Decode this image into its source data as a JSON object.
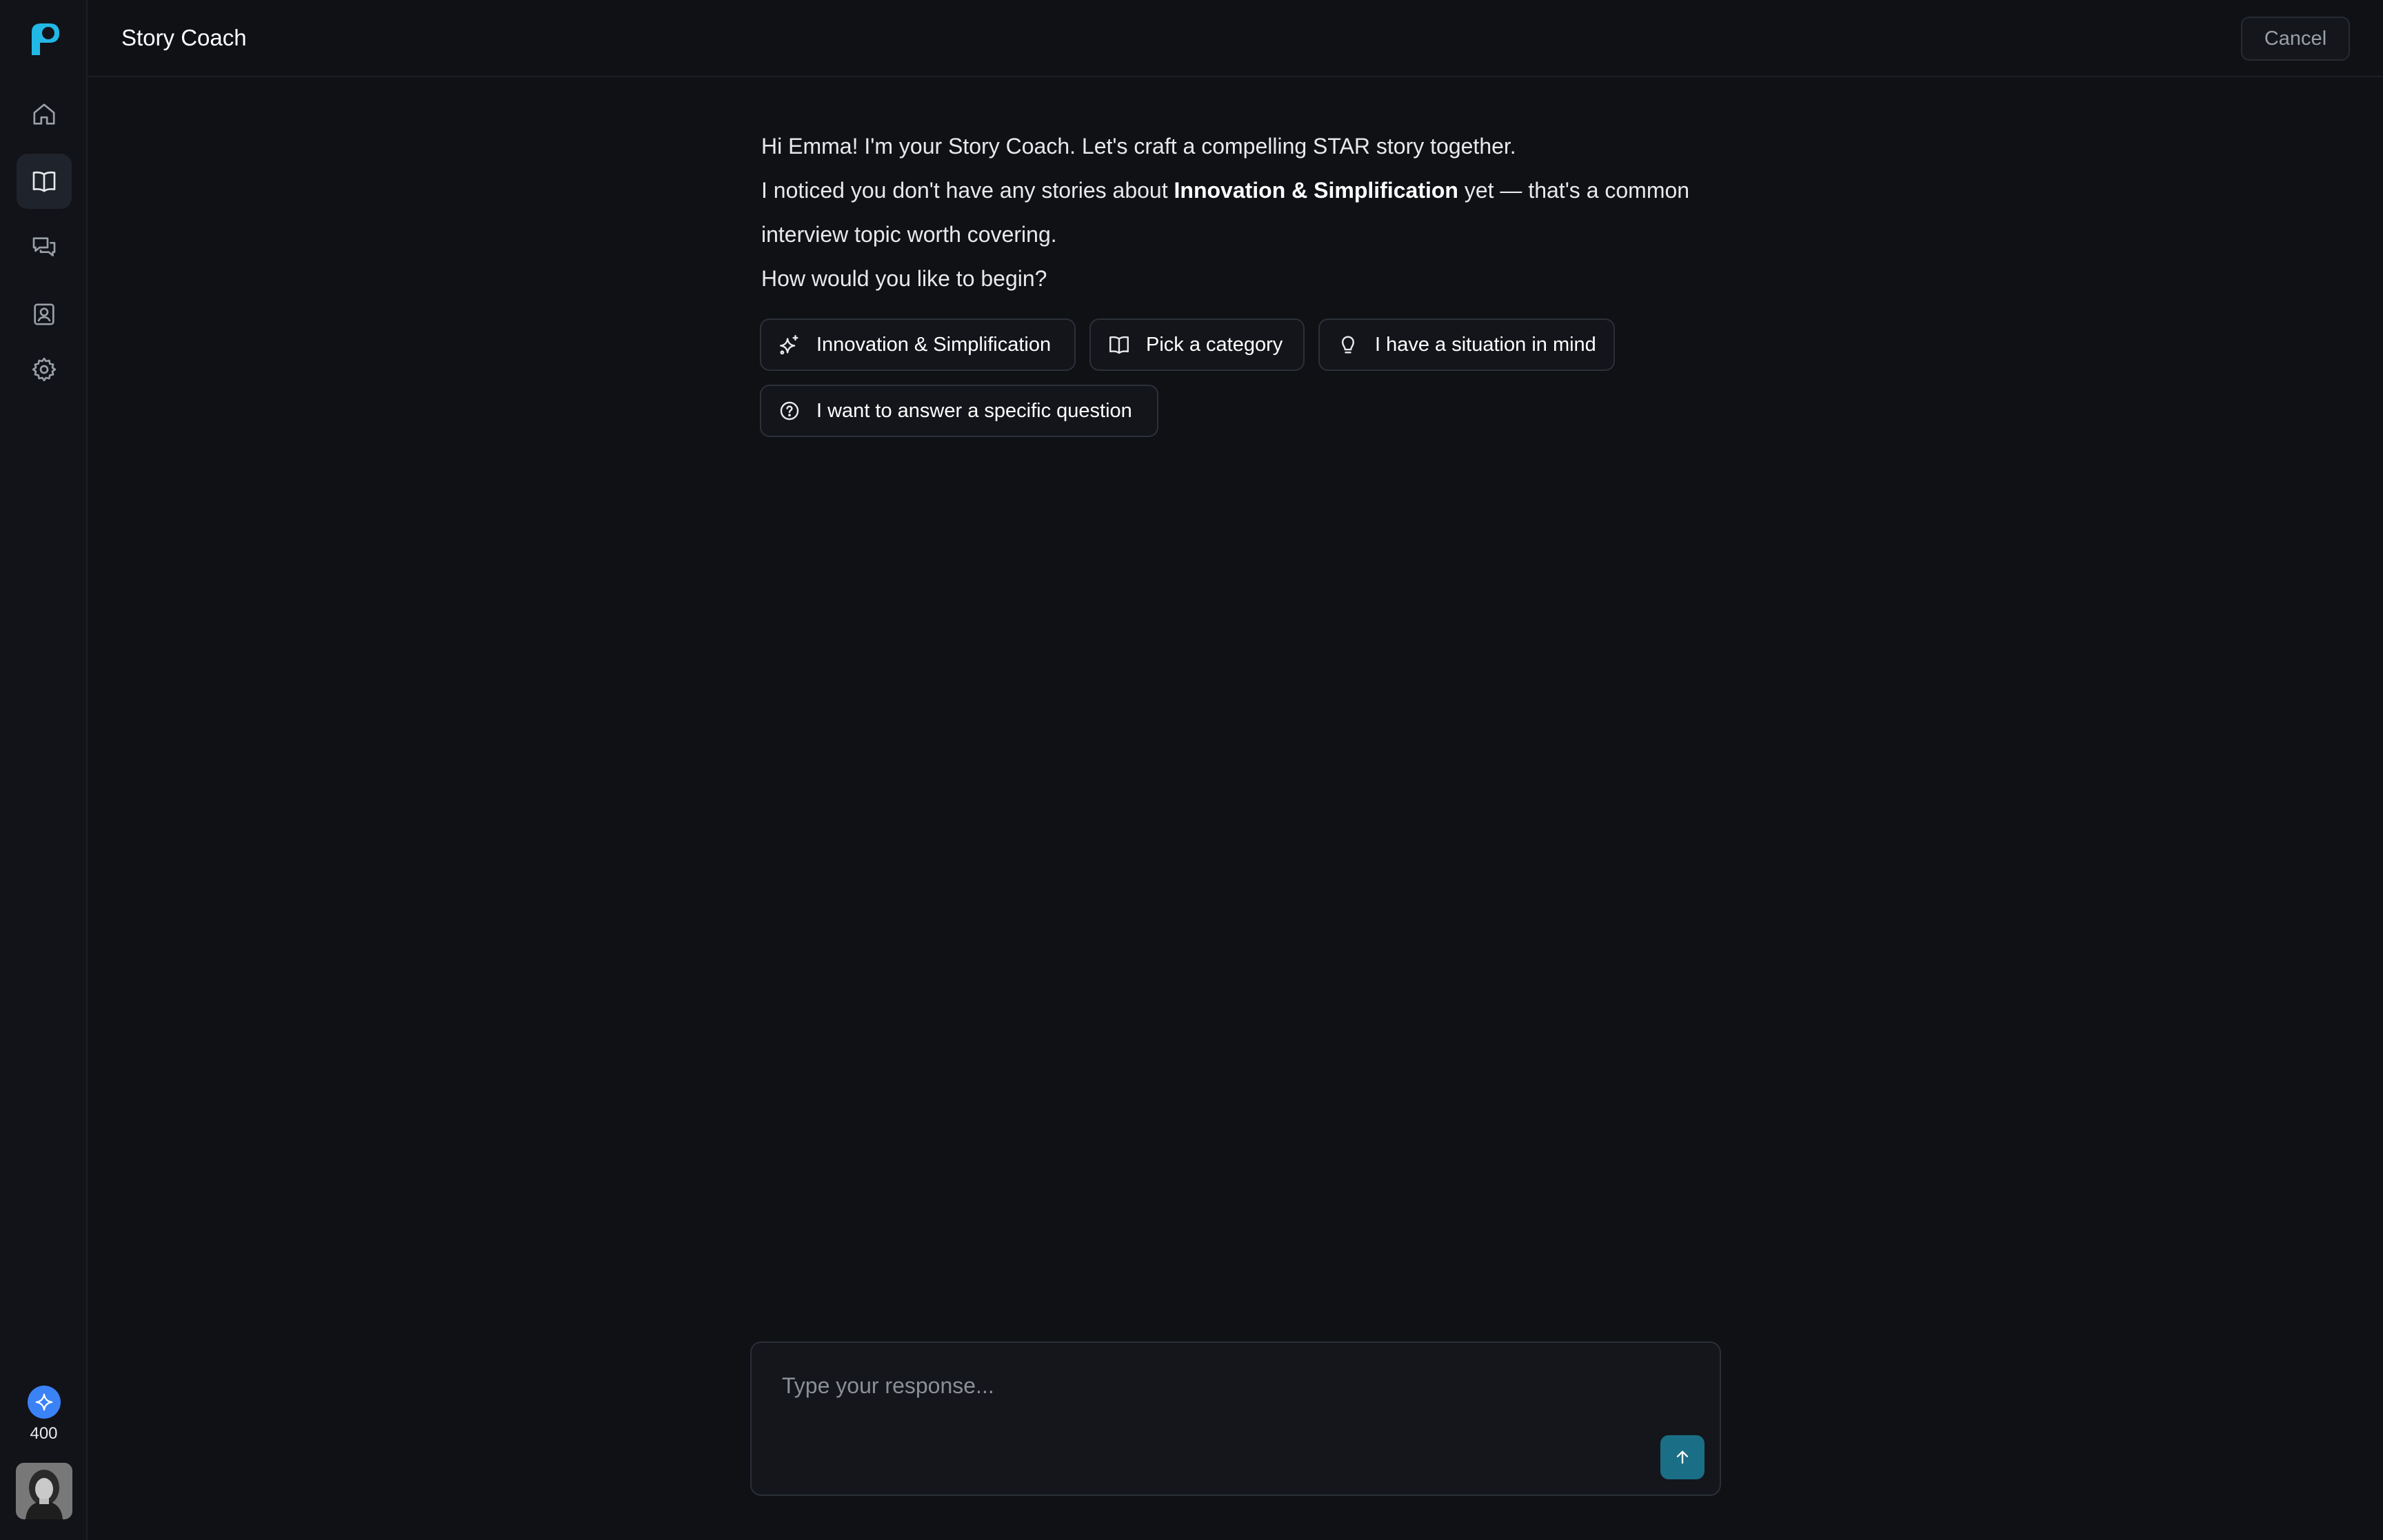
{
  "header": {
    "title": "Story Coach",
    "cancel_label": "Cancel"
  },
  "sidebar": {
    "items": [
      {
        "name": "home"
      },
      {
        "name": "stories",
        "active": true
      },
      {
        "name": "conversations"
      },
      {
        "name": "profile"
      },
      {
        "name": "settings"
      }
    ],
    "credits": "400"
  },
  "chat": {
    "line1": "Hi Emma! I'm your Story Coach. Let's craft a compelling STAR story together.",
    "line2_pre": "I noticed you don't have any stories about ",
    "line2_bold": "Innovation & Simplification",
    "line2_post": " yet — that's a common",
    "line3": "interview topic worth covering.",
    "line4": "How would you like to begin?"
  },
  "options": [
    {
      "label": "Innovation & Simplification",
      "icon": "sparkles-icon"
    },
    {
      "label": "Pick a category",
      "icon": "book-open-icon"
    },
    {
      "label": "I have a situation in mind",
      "icon": "lightbulb-icon"
    },
    {
      "label": "I want to answer a specific question",
      "icon": "help-circle-icon"
    }
  ],
  "composer": {
    "placeholder": "Type your response..."
  },
  "colors": {
    "accent": "#1a6f86",
    "logo": "#22b8e6",
    "credit_badge": "#3b82f6",
    "background": "#0f1115"
  }
}
